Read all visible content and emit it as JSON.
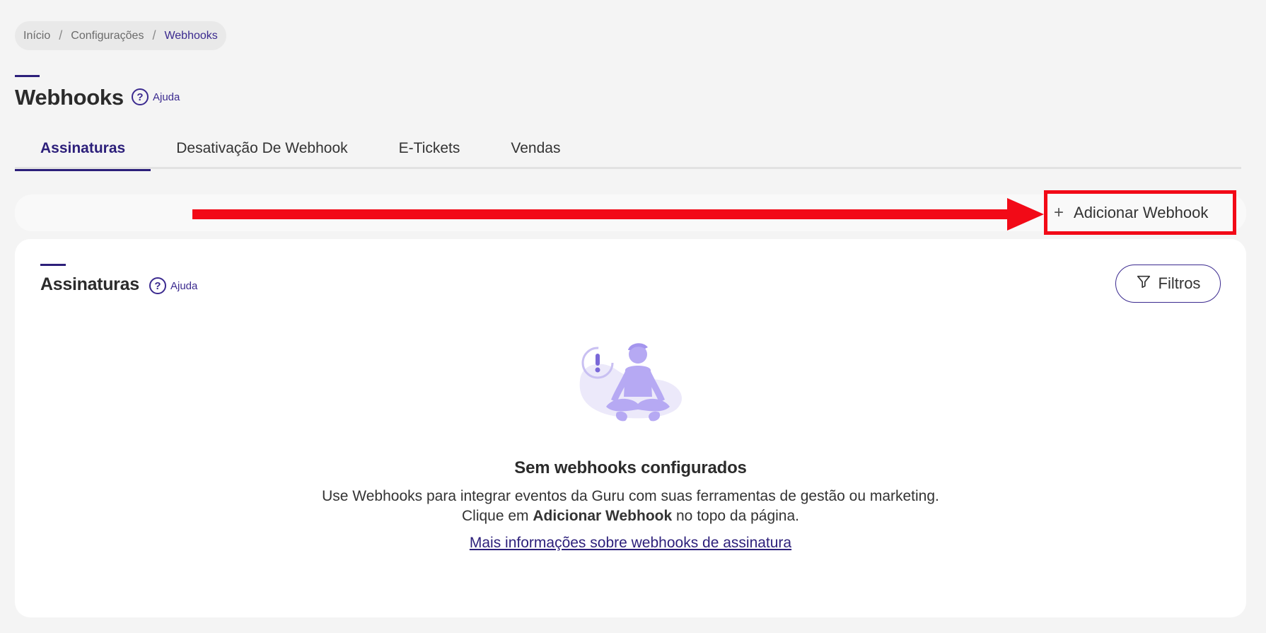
{
  "breadcrumb": {
    "items": [
      "Início",
      "Configurações",
      "Webhooks"
    ],
    "separator": "/"
  },
  "header": {
    "title": "Webhooks",
    "help_label": "Ajuda",
    "help_icon": "question-circle-icon"
  },
  "tabs": [
    {
      "label": "Assinaturas",
      "active": true
    },
    {
      "label": "Desativação De Webhook",
      "active": false
    },
    {
      "label": "E-Tickets",
      "active": false
    },
    {
      "label": "Vendas",
      "active": false
    }
  ],
  "toolbar": {
    "add_icon": "plus-icon",
    "add_label": "Adicionar Webhook"
  },
  "annotation": {
    "arrow_color": "#f20a17",
    "highlight_color": "#f20a17"
  },
  "card": {
    "title": "Assinaturas",
    "help_label": "Ajuda",
    "filter_icon": "filter-icon",
    "filter_label": "Filtros"
  },
  "empty_state": {
    "illustration": "meditating-person-alert-illustration",
    "title": "Sem webhooks configurados",
    "line1": "Use Webhooks para integrar eventos da Guru com suas ferramentas de gestão ou marketing.",
    "line2_prefix": "Clique em ",
    "line2_bold": "Adicionar Webhook",
    "line2_suffix": " no topo da página.",
    "link": "Mais informações sobre webhooks de assinatura"
  },
  "colors": {
    "accent": "#2c1f7a",
    "background": "#f4f4f4",
    "card": "#ffffff"
  }
}
